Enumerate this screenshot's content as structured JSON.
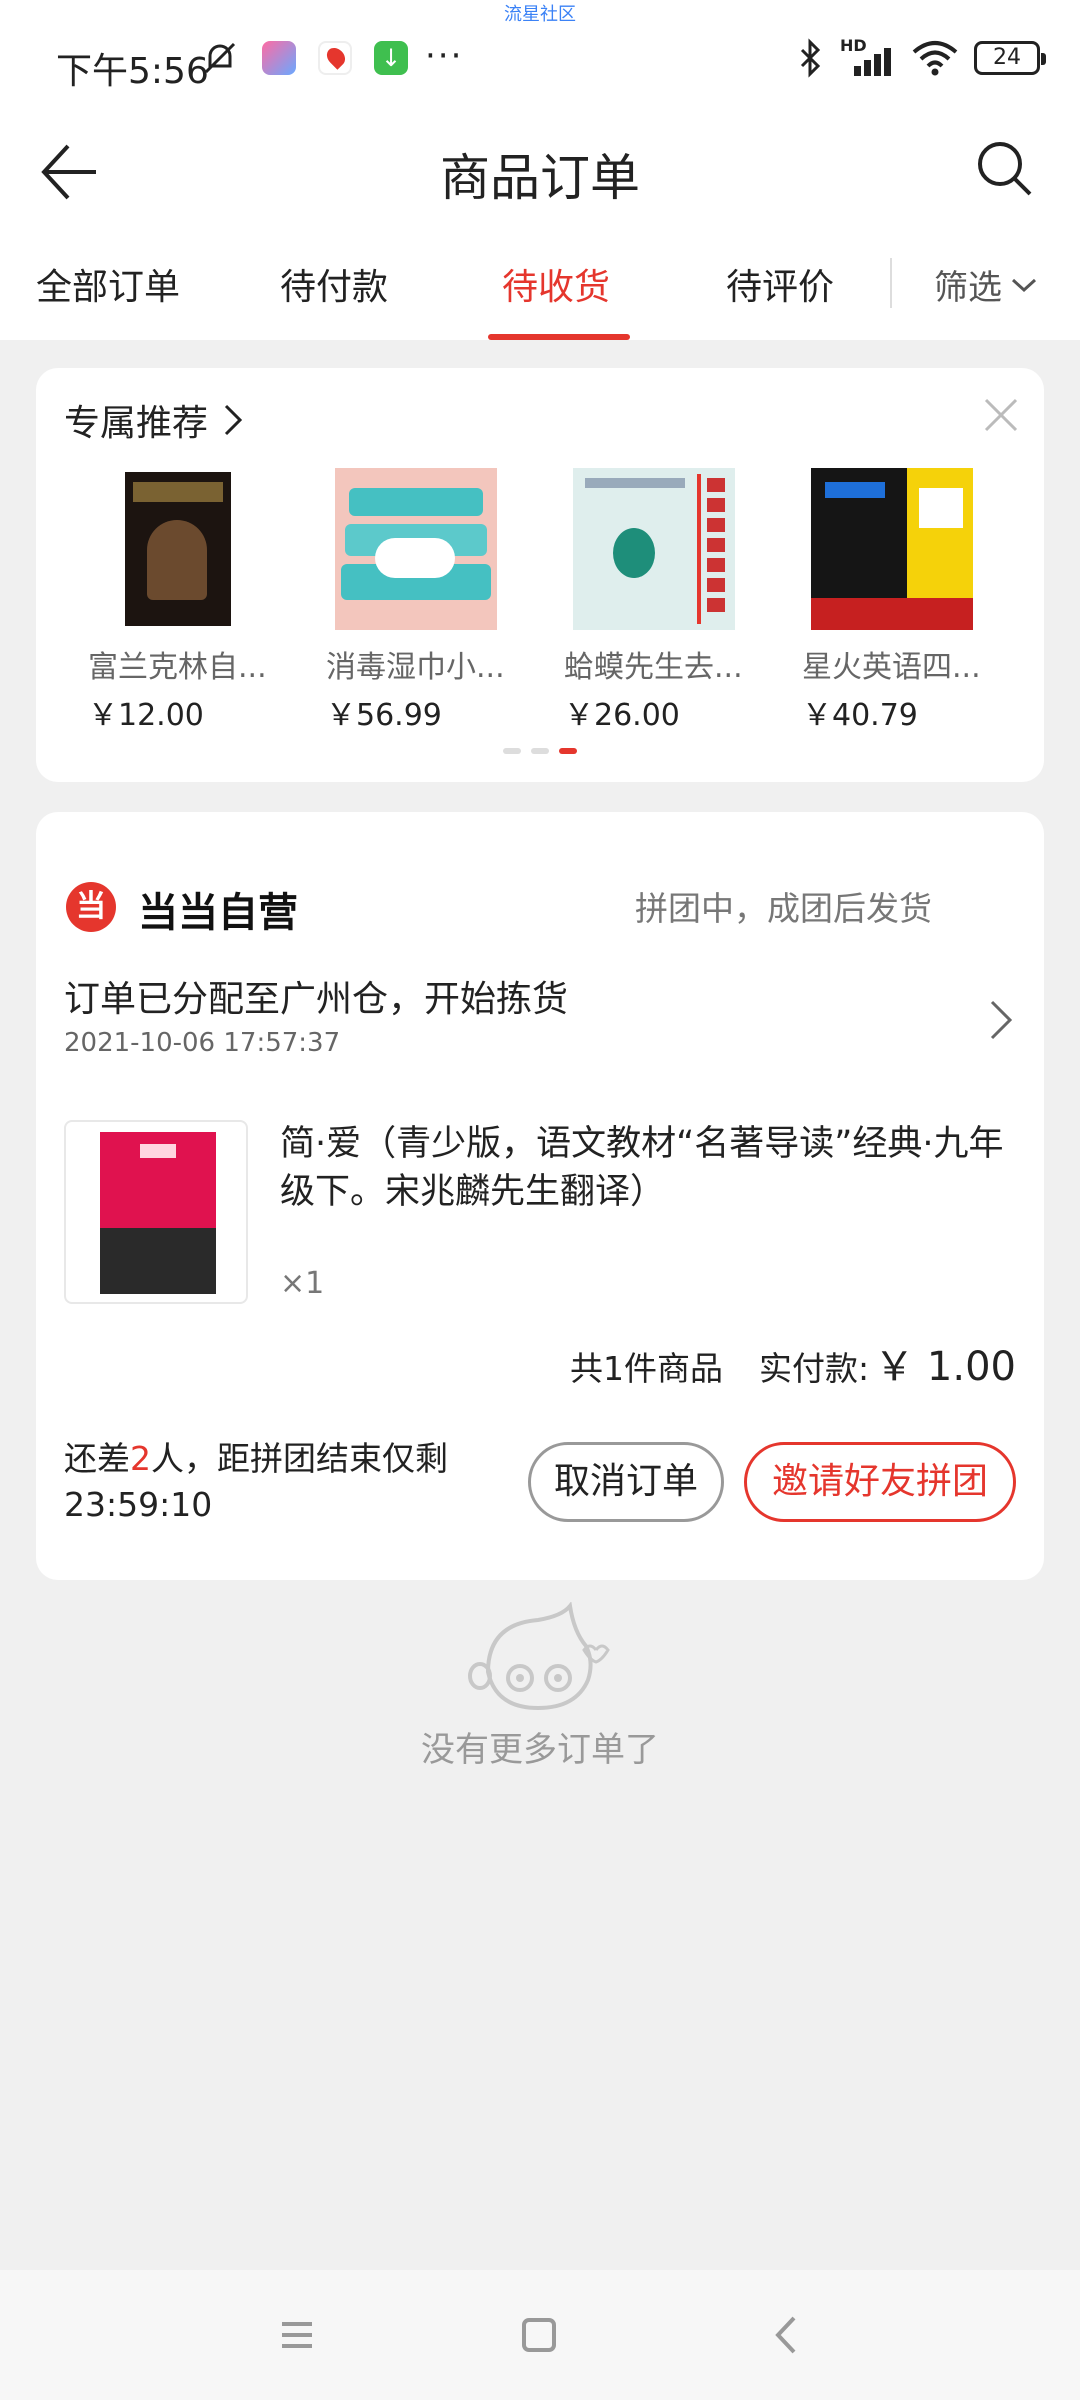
{
  "status_bar": {
    "time": "下午5:56",
    "watermark": "流星社区",
    "battery": "24",
    "hd": "HD",
    "signal_sub": "6"
  },
  "header": {
    "title": "商品订单"
  },
  "tabs": {
    "items": [
      "全部订单",
      "待付款",
      "待收货",
      "待评价"
    ],
    "active_index": 2,
    "filter_label": "筛选"
  },
  "recommend": {
    "title": "专属推荐",
    "items": [
      {
        "name": "富兰克林自...",
        "price": "￥12.00"
      },
      {
        "name": "消毒湿巾小...",
        "price": "￥56.99"
      },
      {
        "name": "蛤蟆先生去...",
        "price": "￥26.00"
      },
      {
        "name": "星火英语四...",
        "price": "￥40.79"
      }
    ],
    "dots_count": 3,
    "active_dot": 2
  },
  "order": {
    "shop_name": "当当自营",
    "status": "拼团中，成团后发货",
    "logistics_text": "订单已分配至广州仓，开始拣货",
    "logistics_time": "2021-10-06 17:57:37",
    "product_title": "简·爱（青少版，语文教材“名著导读”经典·九年级下。宋兆麟先生翻译）",
    "quantity": "×1",
    "total_count": "共1件商品",
    "total_label": "实付款:",
    "total_price": "￥ 1.00",
    "group_prefix": "还差",
    "group_num": "2",
    "group_suffix": "人，距拼团结束仅剩",
    "group_countdown": "23:59:10",
    "cancel_label": "取消订单",
    "invite_label": "邀请好友拼团"
  },
  "empty": {
    "text": "没有更多订单了"
  },
  "colors": {
    "accent": "#e5362d",
    "background": "#f0f0f0"
  }
}
